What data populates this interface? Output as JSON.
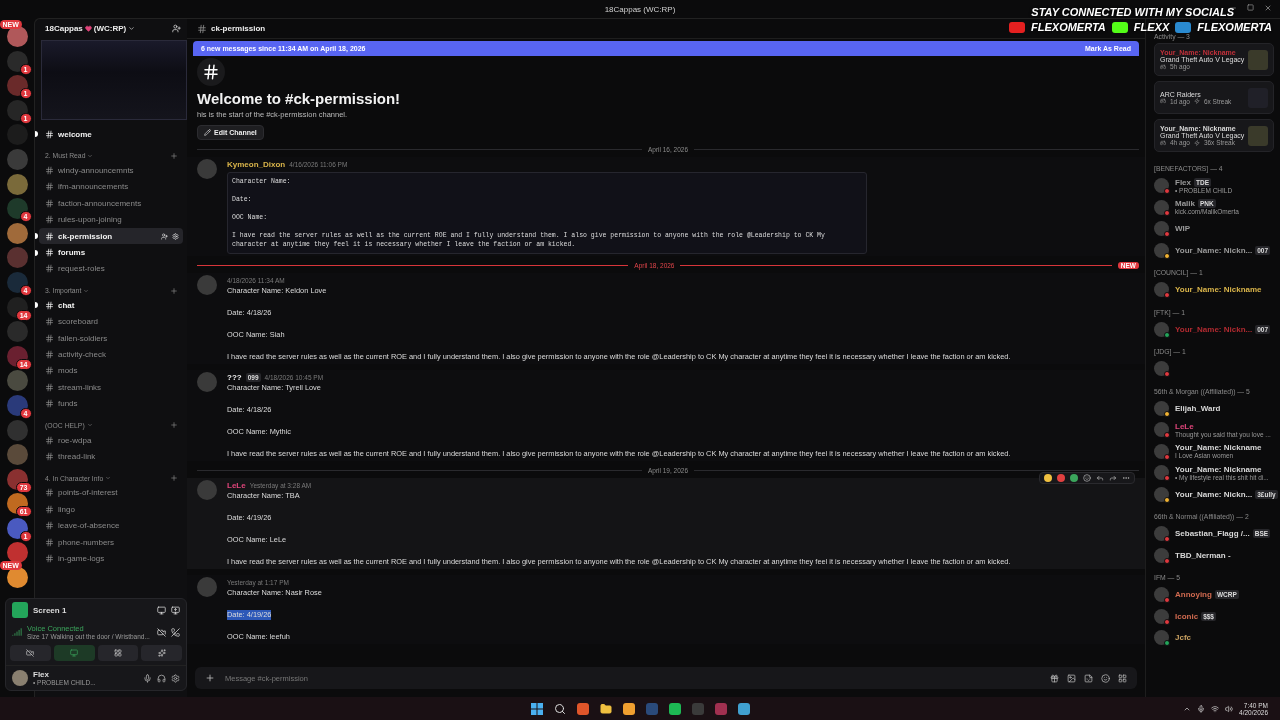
{
  "title_bar": {
    "server": "18Cappas",
    "suffix": "(WC:RP)"
  },
  "overlay": {
    "headline": "STAY CONNECTED WITH MY SOCIALS",
    "handles": [
      {
        "kind": "youtube",
        "name": "FLEXOMERTA"
      },
      {
        "kind": "kick",
        "name": "FLEXX"
      },
      {
        "kind": "x",
        "name": "FLEXOMERTA"
      }
    ]
  },
  "servers": [
    {
      "badge": "NEW",
      "color": "#b0585a"
    },
    {
      "badge": "1",
      "color": "#2a2a2a"
    },
    {
      "badge": "1",
      "color": "#6a2a2a"
    },
    {
      "badge": "1",
      "color": "#262626"
    },
    {
      "color": "#1c1c1c"
    },
    {
      "color": "#3a3a3a"
    },
    {
      "color": "#7a6a3a"
    },
    {
      "badge": "4",
      "color": "#1e3a2a"
    },
    {
      "color": "#a06a3a"
    },
    {
      "color": "#5a3030"
    },
    {
      "badge": "4",
      "color": "#1a2a3a"
    },
    {
      "badge": "14",
      "color": "#202020"
    },
    {
      "color": "#2a2a2a"
    },
    {
      "badge": "14",
      "color": "#6a2030"
    },
    {
      "color": "#4a4a40"
    },
    {
      "badge": "4",
      "color": "#2a3a7a"
    },
    {
      "color": "#303030"
    },
    {
      "color": "#5a4a3a"
    },
    {
      "badge": "73",
      "color": "#8a3030"
    },
    {
      "badge": "61",
      "color": "#c06a20"
    },
    {
      "badge": "1",
      "color": "#4a5ac0"
    },
    {
      "color": "#c03030"
    },
    {
      "badge": "NEW",
      "color": "#e08a30"
    }
  ],
  "sidebar": {
    "server_name": "18Cappas",
    "server_suffix": "(WC:RP)",
    "groups": [
      {
        "channels": [
          {
            "name": "welcome",
            "unread": true,
            "selected": false
          }
        ]
      },
      {
        "title": "2. Must Read",
        "channels": [
          {
            "name": "windy-announcemnts",
            "unread": false,
            "selected": false
          },
          {
            "name": "ifm-announcements",
            "unread": false,
            "selected": false
          },
          {
            "name": "faction-announcements",
            "unread": false,
            "selected": false
          },
          {
            "name": "rules-upon-joining",
            "unread": false,
            "selected": false
          },
          {
            "name": "ck-permission",
            "unread": true,
            "selected": true
          },
          {
            "name": "forums",
            "unread": true,
            "selected": false
          },
          {
            "name": "request-roles",
            "unread": false,
            "selected": false
          }
        ]
      },
      {
        "title": "3. Important",
        "channels": [
          {
            "name": "chat",
            "unread": true,
            "selected": false
          },
          {
            "name": "scoreboard",
            "unread": false,
            "selected": false
          },
          {
            "name": "fallen-soldiers",
            "unread": false,
            "selected": false
          },
          {
            "name": "activity-check",
            "unread": false,
            "selected": false
          },
          {
            "name": "mods",
            "unread": false,
            "selected": false
          },
          {
            "name": "stream-links",
            "unread": false,
            "selected": false
          },
          {
            "name": "funds",
            "unread": false,
            "selected": false
          }
        ]
      },
      {
        "title": "(OOC HELP)",
        "channels": [
          {
            "name": "roe-wdpa",
            "unread": false,
            "selected": false
          },
          {
            "name": "thread-link",
            "unread": false,
            "selected": false
          }
        ]
      },
      {
        "title": "4. In Character Info",
        "channels": [
          {
            "name": "points-of-interest",
            "unread": false,
            "selected": false
          },
          {
            "name": "lingo",
            "unread": false,
            "selected": false
          },
          {
            "name": "leave-of-absence",
            "unread": false,
            "selected": false
          },
          {
            "name": "phone-numbers",
            "unread": false,
            "selected": false
          },
          {
            "name": "in-game-logs",
            "unread": false,
            "selected": false
          }
        ]
      }
    ],
    "stream": {
      "title": "Screen 1"
    },
    "voice": {
      "status": "Voice Connected",
      "detail": "Size 17 Walking out the door / Wristband..."
    },
    "user": {
      "name": "Flex",
      "status_text": "• PROBLEM CHILD..."
    }
  },
  "channel": {
    "name": "ck-permission",
    "new_bar": "6 new messages since 11:34 AM on April 18, 2026",
    "mark_read": "Mark As Read",
    "welcome_title": "Welcome to #ck-permission!",
    "welcome_text": "his is the start of the #ck-permission channel.",
    "edit_button": "Edit Channel",
    "items": [
      {
        "kind": "divider",
        "label": "April 16, 2026",
        "new": false
      },
      {
        "kind": "code_message",
        "author": "Kymeon_Dixon",
        "color": "#d9b44a",
        "time": "4/16/2026 11:06 PM",
        "hovered": false,
        "paragraphs": [
          {
            "text": "Character Name:",
            "selected": false
          },
          {
            "text": "Date:",
            "selected": false
          },
          {
            "text": "OOC Name:",
            "selected": false
          },
          {
            "text": "I have read the server rules as well as the current ROE and I fully understand them. I also give permission to anyone with the role @Leadership to CK My character at anytime they feel it is necessary whether I leave the faction or am kicked.",
            "selected": false
          }
        ]
      },
      {
        "kind": "divider",
        "label": "April 18, 2026",
        "new": true,
        "badge": "NEW"
      },
      {
        "kind": "message",
        "time": "4/18/2026 11:34 AM",
        "hovered": false,
        "paragraphs": [
          {
            "text": "Character Name: Keldon Love",
            "selected": false
          },
          {
            "text": "Date: 4/18/26",
            "selected": false
          },
          {
            "text": "OOC Name: Siah",
            "selected": false
          },
          {
            "text": "I have read the server rules as well as the current ROE and I fully understand them. I also give permission to anyone with the role @Leadership to CK My character at anytime they feel it is necessary whether I leave the faction or am kicked.",
            "selected": false
          }
        ]
      },
      {
        "kind": "message",
        "author": "???",
        "tag": "099",
        "time": "4/18/2026 10:45 PM",
        "hovered": false,
        "paragraphs": [
          {
            "text": "Character Name:  Tyrell Love",
            "selected": false
          },
          {
            "text": "Date: 4/18/26",
            "selected": false
          },
          {
            "text": "OOC Name: Mythic",
            "selected": false
          },
          {
            "text": "I have read the server rules as well as the current ROE and I fully understand them. I also give permission to anyone with the role @Leadership to CK My character at anytime they feel it is necessary whether I leave the faction or am kicked.",
            "selected": false
          }
        ]
      },
      {
        "kind": "divider",
        "label": "April 19, 2026",
        "new": false
      },
      {
        "kind": "message",
        "author": "LeLe",
        "color": "#e0457b",
        "time": "Yesterday at 3:28 AM",
        "hovered": true,
        "paragraphs": [
          {
            "text": "Character Name:  TBA",
            "selected": false
          },
          {
            "text": "Date: 4/19/26",
            "selected": false
          },
          {
            "text": "OOC Name: LeLe",
            "selected": false
          },
          {
            "text": "I have read the server rules as well as the current ROE and I fully understand them. I also give permission to anyone with the role @Leadership to CK My character at anytime they feel it is necessary whether I leave the faction or am kicked.",
            "selected": false
          }
        ]
      },
      {
        "kind": "message",
        "time": "Yesterday at 1:17 PM",
        "hovered": false,
        "paragraphs": [
          {
            "text": "Character Name: Nasir Rose",
            "selected": false
          },
          {
            "text": "Date: 4/19/26",
            "selected": true
          },
          {
            "text": "OOC Name: leefuh",
            "selected": false
          }
        ]
      }
    ],
    "input_placeholder": "Message #ck-permission"
  },
  "members": {
    "activity_title": "Activity — 3",
    "activities": [
      {
        "user": "Your_Name: Nickname",
        "color": "#c0303a",
        "game": "Grand Theft Auto V Legacy",
        "ago": "5h ago"
      },
      {
        "game": "ARC Raiders",
        "ago": "1d ago",
        "streak": "6x Streak"
      },
      {
        "user": "Your_Name: Nickname",
        "color": "#d8d8d8",
        "game": "Grand Theft Auto V Legacy",
        "ago": "4h ago",
        "streak": "36x Streak"
      }
    ],
    "sections": [
      {
        "title": "[BENEFACTORS] — 4",
        "members": [
          {
            "name": "Flex",
            "color": "#9a9a9a",
            "kind": "dnd",
            "tag": "TDE",
            "subtitle": "• PROBLEM CHILD"
          },
          {
            "name": "Malik",
            "color": "#9a9a9a",
            "kind": "dnd",
            "tag": "PNK",
            "subtitle": "kick.com/MalikOmerta"
          },
          {
            "name": "WIP",
            "color": "#9a9a9a",
            "kind": "dnd"
          },
          {
            "name": "Your_Name: Nickn...",
            "color": "#9a9a9a",
            "kind": "idle",
            "tag": "007"
          }
        ]
      },
      {
        "title": "[COUNCIL] — 1",
        "members": [
          {
            "name": "Your_Name: Nickname",
            "color": "#d9b44a",
            "kind": "dnd"
          }
        ]
      },
      {
        "title": "[FTK] — 1",
        "members": [
          {
            "name": "Your_Name: Nickn...",
            "color": "#b02a30",
            "kind": "mobile",
            "tag": "007"
          }
        ]
      },
      {
        "title": "[JDG] — 1",
        "members": [
          {
            "kind": "dnd"
          }
        ]
      },
      {
        "title": "56th & Morgan ((Affiliated)) — 5",
        "members": [
          {
            "name": "Elijah_Ward",
            "color": "#d8d8d8",
            "kind": "idle"
          },
          {
            "name": "LeLe",
            "color": "#e0457b",
            "kind": "dnd",
            "subtitle": "Thought you said that you love ..."
          },
          {
            "name": "Your_Name: Nickname",
            "color": "#d8d8d8",
            "kind": "dnd",
            "subtitle": "I Love Asian women"
          },
          {
            "name": "Your_Name: Nickname",
            "color": "#d8d8d8",
            "kind": "dnd",
            "subtitle": "• My lifestyle real this shit hit di..."
          },
          {
            "name": "Your_Name: Nickn...",
            "color": "#d8d8d8",
            "kind": "idle",
            "tag": "3£ully"
          }
        ]
      },
      {
        "title": "66th & Normal ((Affiliated)) — 2",
        "members": [
          {
            "name": "Sebastian_Flagg /...",
            "color": "#d8d8d8",
            "kind": "dnd",
            "tag": "BSE"
          },
          {
            "name": "TBD_Nerman -",
            "color": "#d8d8d8",
            "kind": "dnd"
          }
        ]
      },
      {
        "title": "IFM — 5",
        "members": [
          {
            "name": "Annoying",
            "color": "#d06a50",
            "kind": "dnd",
            "tag": "WCRP"
          },
          {
            "name": "Iconic",
            "color": "#d06a50",
            "kind": "dnd",
            "tag": "$$$"
          },
          {
            "name": "Jcfc",
            "color": "#c8a060",
            "kind": "online"
          }
        ]
      }
    ]
  },
  "taskbar": {
    "time": "7:40 PM",
    "date": "4/20/2026",
    "apps": [
      {
        "kind": "windows"
      },
      {
        "kind": "search"
      },
      {
        "kind": "app",
        "color": "#e0562a"
      },
      {
        "kind": "folder"
      },
      {
        "kind": "app",
        "color": "#f0a030"
      },
      {
        "kind": "app",
        "color": "#2a4a7a"
      },
      {
        "kind": "app",
        "color": "#1db954"
      },
      {
        "kind": "app",
        "color": "#3a3a3a"
      },
      {
        "kind": "app",
        "color": "#a03050"
      },
      {
        "kind": "app",
        "color": "#40a0d0"
      }
    ]
  }
}
